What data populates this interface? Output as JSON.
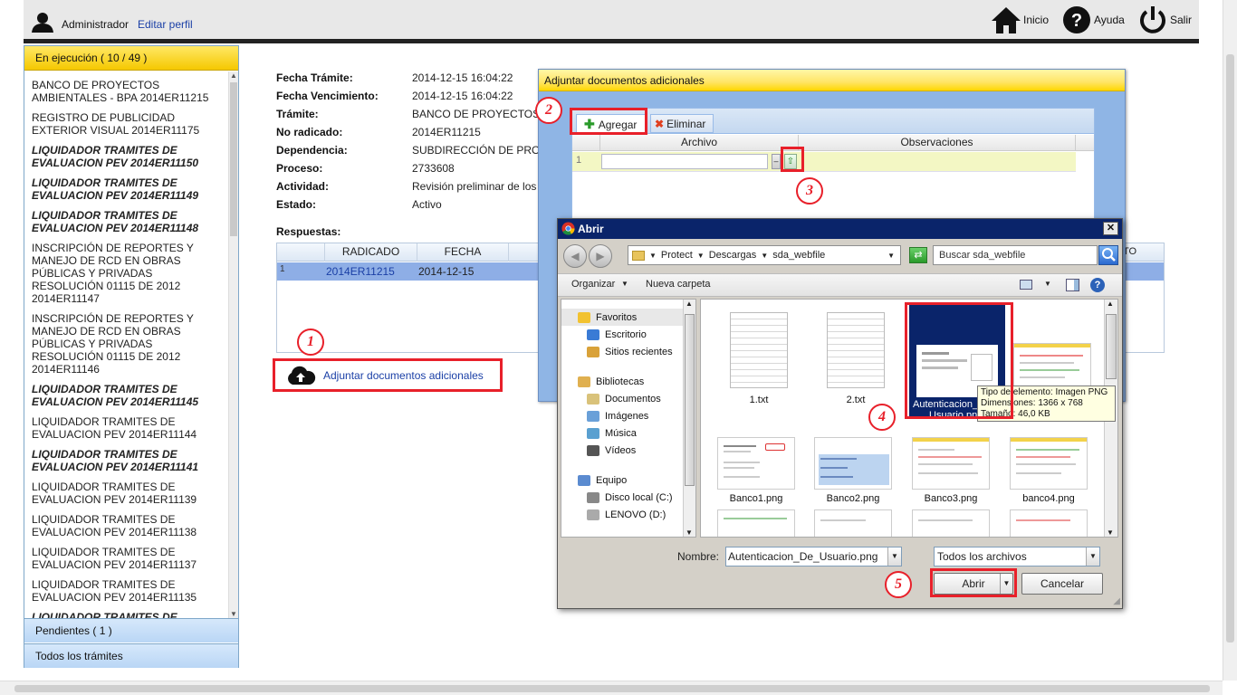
{
  "header": {
    "user": "Administrador",
    "edit_profile": "Editar perfil",
    "nav": [
      {
        "label": "Inicio",
        "icon": "home-icon"
      },
      {
        "label": "Ayuda",
        "icon": "help-icon"
      },
      {
        "label": "Salir",
        "icon": "power-icon"
      }
    ]
  },
  "sidebar": {
    "sections": [
      {
        "label": "En ejecución ( 10 / 49 )"
      },
      {
        "label": "Pendientes ( 1 )"
      },
      {
        "label": "Todos los trámites"
      }
    ],
    "items": [
      {
        "text": "BANCO DE PROYECTOS AMBIENTALES - BPA 2014ER11215",
        "bold": false
      },
      {
        "text": "REGISTRO DE PUBLICIDAD EXTERIOR VISUAL 2014ER11175",
        "bold": false
      },
      {
        "text": "LIQUIDADOR TRAMITES DE EVALUACION PEV 2014ER11150",
        "bold": true
      },
      {
        "text": "LIQUIDADOR TRAMITES DE EVALUACION PEV 2014ER11149",
        "bold": true
      },
      {
        "text": "LIQUIDADOR TRAMITES DE EVALUACION PEV 2014ER11148",
        "bold": true
      },
      {
        "text": "INSCRIPCIÓN DE REPORTES Y MANEJO DE RCD EN OBRAS PÚBLICAS Y PRIVADAS RESOLUCIÓN 01115 DE 2012 2014ER11147",
        "bold": false
      },
      {
        "text": "INSCRIPCIÓN DE REPORTES Y MANEJO DE RCD EN OBRAS PÚBLICAS Y PRIVADAS RESOLUCIÓN 01115 DE 2012 2014ER11146",
        "bold": false
      },
      {
        "text": "LIQUIDADOR TRAMITES DE EVALUACION PEV 2014ER11145",
        "bold": true
      },
      {
        "text": "LIQUIDADOR TRAMITES DE EVALUACION PEV 2014ER11144",
        "bold": false
      },
      {
        "text": "LIQUIDADOR TRAMITES DE EVALUACION PEV 2014ER11141",
        "bold": true
      },
      {
        "text": "LIQUIDADOR TRAMITES DE EVALUACION PEV 2014ER11139",
        "bold": false
      },
      {
        "text": "LIQUIDADOR TRAMITES DE EVALUACION PEV 2014ER11138",
        "bold": false
      },
      {
        "text": "LIQUIDADOR TRAMITES DE EVALUACION PEV 2014ER11137",
        "bold": false
      },
      {
        "text": "LIQUIDADOR TRAMITES DE EVALUACION PEV 2014ER11135",
        "bold": false
      },
      {
        "text": "LIQUIDADOR TRAMITES DE",
        "bold": true
      }
    ]
  },
  "details": {
    "fields": [
      {
        "label": "Fecha Trámite:",
        "value": "2014-12-15 16:04:22"
      },
      {
        "label": "Fecha Vencimiento:",
        "value": "2014-12-15 16:04:22"
      },
      {
        "label": "Trámite:",
        "value": "BANCO DE PROYECTOS"
      },
      {
        "label": "No radicado:",
        "value": "2014ER11215"
      },
      {
        "label": "Dependencia:",
        "value": "SUBDIRECCIÓN DE PRO"
      },
      {
        "label": "Proceso:",
        "value": "2733608"
      },
      {
        "label": "Actividad:",
        "value": "Revisión preliminar de los"
      },
      {
        "label": "Estado:",
        "value": "Activo"
      }
    ],
    "responses_label": "Respuestas:",
    "table": {
      "columns": [
        "RADICADO",
        "FECHA",
        "NTO"
      ],
      "rows": [
        {
          "num": "1",
          "radicado": "2014ER11215",
          "fecha": "2014-12-15"
        }
      ]
    },
    "attach_link": "Adjuntar documentos adicionales"
  },
  "attach_dialog": {
    "title": "Adjuntar documentos adicionales",
    "add_button": "Agregar",
    "delete_button": "Eliminar",
    "columns": [
      "Archivo",
      "Observaciones"
    ],
    "row_number": "1"
  },
  "open_dialog": {
    "title": "Abrir",
    "path": [
      "Protect",
      "Descargas",
      "sda_webfile"
    ],
    "search_placeholder": "Buscar sda_webfile",
    "organize": "Organizar",
    "new_folder": "Nueva carpeta",
    "tree": [
      {
        "label": "Favoritos",
        "group": true
      },
      {
        "label": "Escritorio",
        "group": false
      },
      {
        "label": "Sitios recientes",
        "group": false
      },
      {
        "label": "Bibliotecas",
        "group": true
      },
      {
        "label": "Documentos",
        "group": false
      },
      {
        "label": "Imágenes",
        "group": false
      },
      {
        "label": "Música",
        "group": false
      },
      {
        "label": "Vídeos",
        "group": false
      },
      {
        "label": "Equipo",
        "group": true
      },
      {
        "label": "Disco local (C:)",
        "group": false
      },
      {
        "label": "LENOVO (D:)",
        "group": false
      }
    ],
    "files": [
      {
        "name": "1.txt"
      },
      {
        "name": "2.txt"
      },
      {
        "name": "Autenticacion_De_Usuario.png",
        "display": "Autenticacion_",
        "display2": "Usuario.png"
      },
      {
        "name": "",
        "display": "g"
      },
      {
        "name": "Banco1.png"
      },
      {
        "name": "Banco2.png"
      },
      {
        "name": "Banco3.png"
      },
      {
        "name": "banco4.png"
      }
    ],
    "tooltip": [
      "Tipo de elemento: Imagen PNG",
      "Dimensiones: 1366 x 768",
      "Tamaño: 46,0 KB"
    ],
    "filename_label": "Nombre:",
    "filename_value": "Autenticacion_De_Usuario.png",
    "filter_value": "Todos los archivos",
    "open_button": "Abrir",
    "cancel_button": "Cancelar"
  },
  "annotations": [
    "1",
    "2",
    "3",
    "4",
    "5"
  ],
  "colors": {
    "accent_yellow": "#ffd700",
    "annotation_red": "#e8202a",
    "title_blue": "#0a246a",
    "link_blue": "#1a3fa6"
  }
}
